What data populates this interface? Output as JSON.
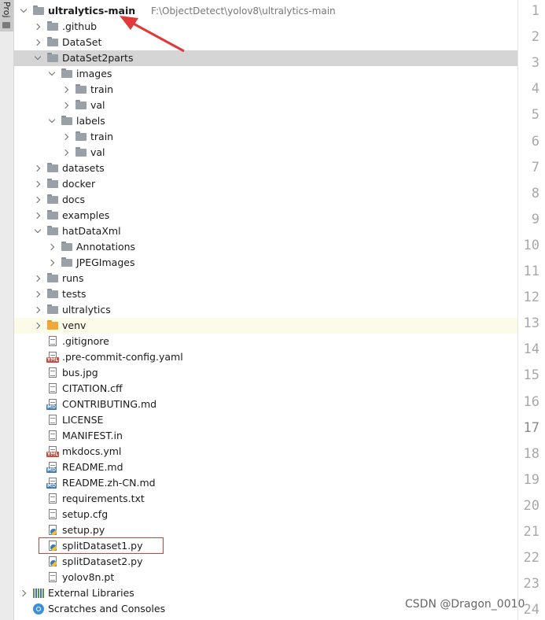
{
  "side_tab": {
    "label": "Proj"
  },
  "root": {
    "name": "ultralytics-main",
    "path": "F:\\ObjectDetect\\yolov8\\ultralytics-main"
  },
  "rows": [
    {
      "label": ".github",
      "level": 1,
      "type": "folder",
      "chev": "closed"
    },
    {
      "label": "DataSet",
      "level": 1,
      "type": "folder",
      "chev": "closed"
    },
    {
      "label": "DataSet2parts",
      "level": 1,
      "type": "folder",
      "chev": "open",
      "selected": true
    },
    {
      "label": "images",
      "level": 2,
      "type": "folder",
      "chev": "open"
    },
    {
      "label": "train",
      "level": 3,
      "type": "folder",
      "chev": "closed"
    },
    {
      "label": "val",
      "level": 3,
      "type": "folder",
      "chev": "closed"
    },
    {
      "label": "labels",
      "level": 2,
      "type": "folder",
      "chev": "open"
    },
    {
      "label": "train",
      "level": 3,
      "type": "folder",
      "chev": "closed"
    },
    {
      "label": "val",
      "level": 3,
      "type": "folder",
      "chev": "closed"
    },
    {
      "label": "datasets",
      "level": 1,
      "type": "folder",
      "chev": "closed"
    },
    {
      "label": "docker",
      "level": 1,
      "type": "folder",
      "chev": "closed"
    },
    {
      "label": "docs",
      "level": 1,
      "type": "folder",
      "chev": "closed"
    },
    {
      "label": "examples",
      "level": 1,
      "type": "folder",
      "chev": "closed"
    },
    {
      "label": "hatDataXml",
      "level": 1,
      "type": "folder",
      "chev": "open"
    },
    {
      "label": "Annotations",
      "level": 2,
      "type": "folder",
      "chev": "closed"
    },
    {
      "label": "JPEGImages",
      "level": 2,
      "type": "folder",
      "chev": "closed"
    },
    {
      "label": "runs",
      "level": 1,
      "type": "folder",
      "chev": "closed"
    },
    {
      "label": "tests",
      "level": 1,
      "type": "folder",
      "chev": "closed"
    },
    {
      "label": "ultralytics",
      "level": 1,
      "type": "package",
      "chev": "closed"
    },
    {
      "label": "venv",
      "level": 1,
      "type": "folder-orange",
      "chev": "closed",
      "highlight": true
    },
    {
      "label": ".gitignore",
      "level": 1,
      "type": "file"
    },
    {
      "label": ".pre-commit-config.yaml",
      "level": 1,
      "type": "yml"
    },
    {
      "label": "bus.jpg",
      "level": 1,
      "type": "file"
    },
    {
      "label": "CITATION.cff",
      "level": 1,
      "type": "file"
    },
    {
      "label": "CONTRIBUTING.md",
      "level": 1,
      "type": "md"
    },
    {
      "label": "LICENSE",
      "level": 1,
      "type": "file"
    },
    {
      "label": "MANIFEST.in",
      "level": 1,
      "type": "file"
    },
    {
      "label": "mkdocs.yml",
      "level": 1,
      "type": "yml"
    },
    {
      "label": "README.md",
      "level": 1,
      "type": "md"
    },
    {
      "label": "README.zh-CN.md",
      "level": 1,
      "type": "md"
    },
    {
      "label": "requirements.txt",
      "level": 1,
      "type": "file"
    },
    {
      "label": "setup.cfg",
      "level": 1,
      "type": "file"
    },
    {
      "label": "setup.py",
      "level": 1,
      "type": "py"
    },
    {
      "label": "splitDataset1.py",
      "level": 1,
      "type": "py"
    },
    {
      "label": "splitDataset2.py",
      "level": 1,
      "type": "py"
    },
    {
      "label": "yolov8n.pt",
      "level": 1,
      "type": "file"
    },
    {
      "label": "External Libraries",
      "level": 0,
      "type": "lib",
      "chev": "closed"
    },
    {
      "label": "Scratches and Consoles",
      "level": 0,
      "type": "scratch"
    }
  ],
  "badges": {
    "yml": "YML",
    "md": "MD"
  },
  "line_numbers": [
    "1",
    "2",
    "3",
    "4",
    "5",
    "6",
    "7",
    "8",
    "9",
    "10",
    "11",
    "12",
    "13",
    "14",
    "15",
    "16",
    "17",
    "18",
    "19",
    "20",
    "21",
    "22",
    "23",
    "24"
  ],
  "current_line": "17",
  "watermark": "CSDN @Dragon_0010",
  "colors": {
    "selection": "#d5d5d5",
    "highlight_row": "#fcfbe8",
    "annotation_red": "#e03a3a"
  }
}
